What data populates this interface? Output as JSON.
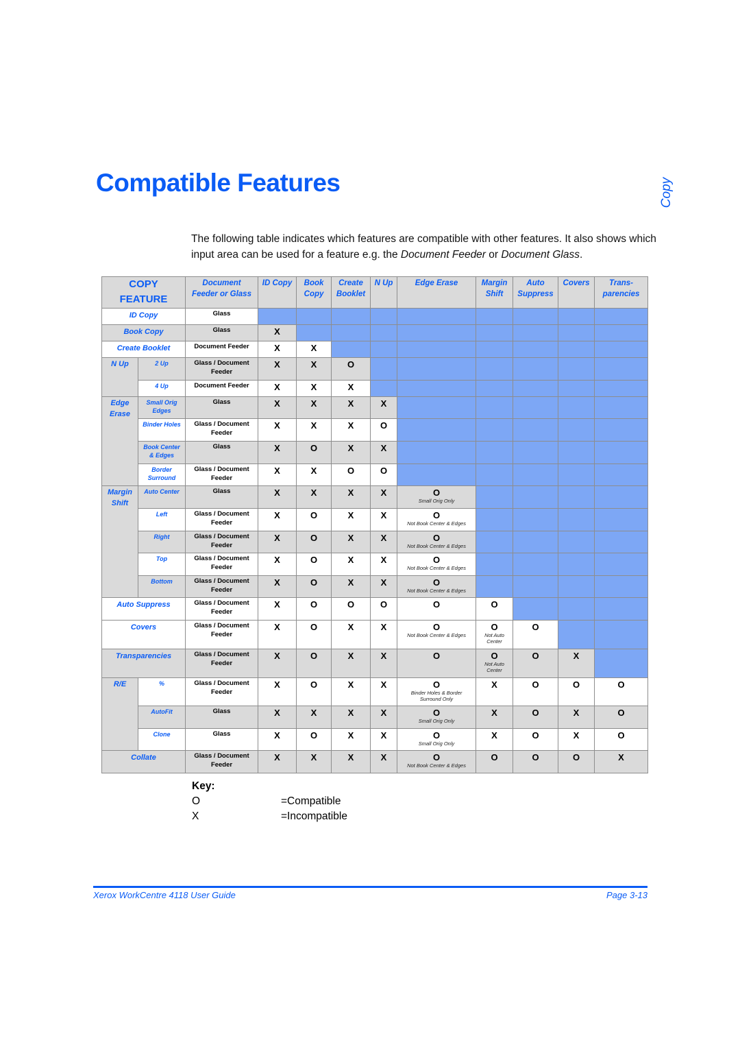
{
  "page": {
    "title": "Compatible Features",
    "side_tab": "Copy",
    "intro": {
      "part1": "The following table indicates which features are compatible with other features. It also shows which input area can be used for a feature e.g. the ",
      "em1": "Document Feeder",
      "part2": " or ",
      "em2": "Document Glass",
      "part3": "."
    }
  },
  "colors": {
    "accent": "#0a5cf5",
    "header_gray": "#dadada",
    "blocked_blue": "#7da7f5",
    "grid_line": "#8d8d8d"
  },
  "table": {
    "corner": {
      "line1": "COPY",
      "line2": "FEATURE"
    },
    "columns": [
      {
        "line1": "Document",
        "line2": "Feeder or Glass"
      },
      {
        "line1": "ID Copy",
        "line2": ""
      },
      {
        "line1": "Book",
        "line2": "Copy"
      },
      {
        "line1": "Create",
        "line2": "Booklet"
      },
      {
        "line1": "N Up",
        "line2": ""
      },
      {
        "line1": "Edge Erase",
        "line2": ""
      },
      {
        "line1": "Margin",
        "line2": "Shift"
      },
      {
        "line1": "Auto",
        "line2": "Suppress"
      },
      {
        "line1": "Covers",
        "line2": ""
      },
      {
        "line1": "Trans-",
        "line2": "parencies"
      }
    ],
    "groups": {
      "n_up": {
        "line1": "N Up",
        "line2": ""
      },
      "edge_erase": {
        "line1": "Edge",
        "line2": "Erase"
      },
      "margin_shift": {
        "line1": "Margin",
        "line2": "Shift"
      },
      "re": {
        "line1": "R/E",
        "line2": ""
      }
    },
    "rows": [
      {
        "feature": "ID Copy",
        "sub": "",
        "source": [
          "Glass"
        ],
        "cells": []
      },
      {
        "feature": "Book Copy",
        "sub": "",
        "source": [
          "Glass"
        ],
        "cells": [
          {
            "m": "X"
          }
        ]
      },
      {
        "feature": "Create Booklet",
        "sub": "",
        "source": [
          "Document Feeder"
        ],
        "cells": [
          {
            "m": "X"
          },
          {
            "m": "X"
          }
        ]
      },
      {
        "feature": "N Up",
        "sub": "2 Up",
        "source": [
          "Glass / Document",
          "Feeder"
        ],
        "cells": [
          {
            "m": "X"
          },
          {
            "m": "X"
          },
          {
            "m": "O"
          }
        ]
      },
      {
        "feature": "N Up",
        "sub": "4 Up",
        "source": [
          "Document Feeder"
        ],
        "cells": [
          {
            "m": "X"
          },
          {
            "m": "X"
          },
          {
            "m": "X"
          }
        ]
      },
      {
        "feature": "Edge Erase",
        "sub": "Small Orig Edges",
        "sub_lines": [
          "Small Orig",
          "Edges"
        ],
        "source": [
          "Glass"
        ],
        "cells": [
          {
            "m": "X"
          },
          {
            "m": "X"
          },
          {
            "m": "X"
          },
          {
            "m": "X"
          }
        ]
      },
      {
        "feature": "Edge Erase",
        "sub": "Binder Holes",
        "sub_lines": [
          "Binder Holes"
        ],
        "source": [
          "Glass / Document",
          "Feeder"
        ],
        "cells": [
          {
            "m": "X"
          },
          {
            "m": "X"
          },
          {
            "m": "X"
          },
          {
            "m": "O"
          }
        ]
      },
      {
        "feature": "Edge Erase",
        "sub": "Book Center & Edges",
        "sub_lines": [
          "Book Center",
          "& Edges"
        ],
        "source": [
          "Glass"
        ],
        "cells": [
          {
            "m": "X"
          },
          {
            "m": "O"
          },
          {
            "m": "X"
          },
          {
            "m": "X"
          }
        ]
      },
      {
        "feature": "Edge Erase",
        "sub": "Border Surround",
        "sub_lines": [
          "Border",
          "Surround"
        ],
        "source": [
          "Glass / Document",
          "Feeder"
        ],
        "cells": [
          {
            "m": "X"
          },
          {
            "m": "X"
          },
          {
            "m": "O"
          },
          {
            "m": "O"
          }
        ]
      },
      {
        "feature": "Margin Shift",
        "sub": "Auto Center",
        "sub_lines": [
          "Auto Center"
        ],
        "source": [
          "Glass"
        ],
        "cells": [
          {
            "m": "X"
          },
          {
            "m": "X"
          },
          {
            "m": "X"
          },
          {
            "m": "X"
          },
          {
            "m": "O",
            "n": [
              "Small Orig Only"
            ]
          }
        ]
      },
      {
        "feature": "Margin Shift",
        "sub": "Left",
        "sub_lines": [
          "Left"
        ],
        "source": [
          "Glass / Document",
          "Feeder"
        ],
        "cells": [
          {
            "m": "X"
          },
          {
            "m": "O"
          },
          {
            "m": "X"
          },
          {
            "m": "X"
          },
          {
            "m": "O",
            "n": [
              "Not Book Center & Edges"
            ]
          }
        ]
      },
      {
        "feature": "Margin Shift",
        "sub": "Right",
        "sub_lines": [
          "Right"
        ],
        "source": [
          "Glass / Document",
          "Feeder"
        ],
        "cells": [
          {
            "m": "X"
          },
          {
            "m": "O"
          },
          {
            "m": "X"
          },
          {
            "m": "X"
          },
          {
            "m": "O",
            "n": [
              "Not Book Center & Edges"
            ]
          }
        ]
      },
      {
        "feature": "Margin Shift",
        "sub": "Top",
        "sub_lines": [
          "Top"
        ],
        "source": [
          "Glass / Document",
          "Feeder"
        ],
        "cells": [
          {
            "m": "X"
          },
          {
            "m": "O"
          },
          {
            "m": "X"
          },
          {
            "m": "X"
          },
          {
            "m": "O",
            "n": [
              "Not Book Center & Edges"
            ]
          }
        ]
      },
      {
        "feature": "Margin Shift",
        "sub": "Bottom",
        "sub_lines": [
          "Bottom"
        ],
        "source": [
          "Glass / Document",
          "Feeder"
        ],
        "cells": [
          {
            "m": "X"
          },
          {
            "m": "O"
          },
          {
            "m": "X"
          },
          {
            "m": "X"
          },
          {
            "m": "O",
            "n": [
              "Not Book Center & Edges"
            ]
          }
        ]
      },
      {
        "feature": "Auto Suppress",
        "sub": "",
        "source": [
          "Glass / Document",
          "Feeder"
        ],
        "cells": [
          {
            "m": "X"
          },
          {
            "m": "O"
          },
          {
            "m": "O"
          },
          {
            "m": "O"
          },
          {
            "m": "O"
          },
          {
            "m": "O"
          }
        ]
      },
      {
        "feature": "Covers",
        "sub": "",
        "source": [
          "Glass / Document",
          "Feeder"
        ],
        "cells": [
          {
            "m": "X"
          },
          {
            "m": "O"
          },
          {
            "m": "X"
          },
          {
            "m": "X"
          },
          {
            "m": "O",
            "n": [
              "Not Book Center & Edges"
            ]
          },
          {
            "m": "O",
            "n": [
              "Not Auto",
              "Center"
            ]
          },
          {
            "m": "O"
          }
        ]
      },
      {
        "feature": "Transparencies",
        "sub": "",
        "source": [
          "Glass / Document",
          "Feeder"
        ],
        "cells": [
          {
            "m": "X"
          },
          {
            "m": "O"
          },
          {
            "m": "X"
          },
          {
            "m": "X"
          },
          {
            "m": "O"
          },
          {
            "m": "O",
            "n": [
              "Not Auto",
              "Center"
            ]
          },
          {
            "m": "O"
          },
          {
            "m": "X"
          }
        ]
      },
      {
        "feature": "R/E",
        "sub": "%",
        "sub_lines": [
          "%"
        ],
        "source": [
          "Glass / Document",
          "Feeder"
        ],
        "cells": [
          {
            "m": "X"
          },
          {
            "m": "O"
          },
          {
            "m": "X"
          },
          {
            "m": "X"
          },
          {
            "m": "O",
            "n": [
              "Binder Holes & Border",
              "Surround Only"
            ]
          },
          {
            "m": "X"
          },
          {
            "m": "O"
          },
          {
            "m": "O"
          },
          {
            "m": "O"
          }
        ]
      },
      {
        "feature": "R/E",
        "sub": "AutoFit",
        "sub_lines": [
          "AutoFit"
        ],
        "source": [
          "Glass"
        ],
        "cells": [
          {
            "m": "X"
          },
          {
            "m": "X"
          },
          {
            "m": "X"
          },
          {
            "m": "X"
          },
          {
            "m": "O",
            "n": [
              "Small Orig Only"
            ]
          },
          {
            "m": "X"
          },
          {
            "m": "O"
          },
          {
            "m": "X"
          },
          {
            "m": "O"
          }
        ]
      },
      {
        "feature": "R/E",
        "sub": "Clone",
        "sub_lines": [
          "Clone"
        ],
        "source": [
          "Glass"
        ],
        "cells": [
          {
            "m": "X"
          },
          {
            "m": "O"
          },
          {
            "m": "X"
          },
          {
            "m": "X"
          },
          {
            "m": "O",
            "n": [
              "Small Orig Only"
            ]
          },
          {
            "m": "X"
          },
          {
            "m": "O"
          },
          {
            "m": "X"
          },
          {
            "m": "O"
          }
        ]
      },
      {
        "feature": "Collate",
        "sub": "",
        "source": [
          "Glass / Document",
          "Feeder"
        ],
        "cells": [
          {
            "m": "X"
          },
          {
            "m": "X"
          },
          {
            "m": "X"
          },
          {
            "m": "X"
          },
          {
            "m": "O",
            "n": [
              "Not Book Center & Edges"
            ]
          },
          {
            "m": "O"
          },
          {
            "m": "O"
          },
          {
            "m": "O"
          },
          {
            "m": "X"
          }
        ]
      }
    ]
  },
  "key": {
    "title": "Key:",
    "items": [
      {
        "symbol": "O",
        "meaning": "=Compatible"
      },
      {
        "symbol": "X",
        "meaning": "=Incompatible"
      }
    ]
  },
  "footer": {
    "guide": "Xerox WorkCentre 4118 User Guide",
    "page": "Page 3-13"
  }
}
